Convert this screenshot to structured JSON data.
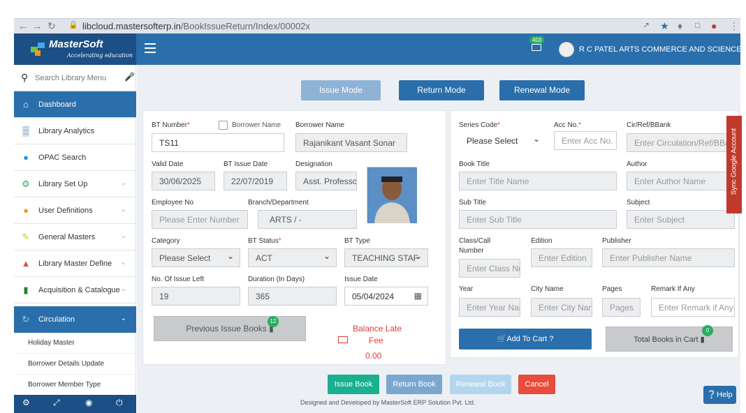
{
  "browser": {
    "url_host": "libcloud.mastersofterp.in",
    "url_path": "/BookIssueReturn/Index/00002x"
  },
  "brand": {
    "name": "MasterSoft",
    "tagline": "Accelerating education"
  },
  "header": {
    "mail_count": "403",
    "college": "R C PATEL ARTS COMMERCE AND SCIENCE COLLEGE"
  },
  "sidebar": {
    "search_placeholder": "Search Library Menu",
    "items": [
      {
        "label": "Dashboard",
        "icon": "home-icon"
      },
      {
        "label": "Library Analytics",
        "icon": "bar-chart-icon"
      },
      {
        "label": "OPAC Search",
        "icon": "globe-icon"
      },
      {
        "label": "Library Set Up",
        "icon": "gears-icon"
      },
      {
        "label": "User Definitions",
        "icon": "users-icon"
      },
      {
        "label": "General Masters",
        "icon": "edit-icon"
      },
      {
        "label": "Library Master Define",
        "icon": "sitemap-icon"
      },
      {
        "label": "Acquisition & Catalogue",
        "icon": "book-icon"
      },
      {
        "label": "Circulation",
        "icon": "refresh-icon"
      }
    ],
    "subitems": [
      "Holiday Master",
      "Borrower Details Update",
      "Borrower Member Type"
    ]
  },
  "modes": {
    "issue": "Issue Mode",
    "return": "Return Mode",
    "renewal": "Renewal Mode"
  },
  "left": {
    "bt_number_label": "BT Number",
    "bt_number": "TS11",
    "borrower_name_check": "Borrower Name",
    "borrower_name_label": "Borrower Name",
    "borrower_name": "Rajanikant Vasant Sonar",
    "valid_date_label": "Valid Date",
    "valid_date": "30/06/2025",
    "bt_issue_date_label": "BT Issue Date",
    "bt_issue_date": "22/07/2019",
    "designation_label": "Designation",
    "designation": "Asst. Professo",
    "employee_no_label": "Employee No",
    "employee_no_ph": "Please Enter Number",
    "branch_label": "Branch/Department",
    "branch": "ARTS / -",
    "category_label": "Category",
    "category": "Please Select",
    "bt_status_label": "BT Status",
    "bt_status": "ACT",
    "bt_type_label": "BT Type",
    "bt_type": "TEACHING STAF",
    "issue_left_label": "No. Of Issue Left",
    "issue_left": "19",
    "duration_label": "Duration (In Days)",
    "duration": "365",
    "issue_date_label": "Issue Date",
    "issue_date": "05/04/2024",
    "prev_books": "Previous Issue Books",
    "prev_count": "12",
    "balance_label_1": "Balance Late",
    "balance_label_2": "Fee",
    "balance_value": "0.00"
  },
  "right": {
    "series_label": "Series Code",
    "series": "Please Select",
    "acc_label": "Acc No.",
    "acc_ph": "Enter Acc No.",
    "cir_label": "Cir/Ref/BBank",
    "cir_ph": "Enter Circulation/Ref/BBank",
    "title_label": "Book Title",
    "title_ph": "Enter Title Name",
    "author_label": "Author",
    "author_ph": "Enter Author Name",
    "subtitle_label": "Sub Title",
    "subtitle_ph": "Enter Sub Title",
    "subject_label": "Subject",
    "subject_ph": "Enter Subject",
    "class_label_1": "Class/Call",
    "class_label_2": "Number",
    "class_ph": "Enter Class Nu",
    "edition_label": "Edition",
    "edition_ph": "Enter Edition",
    "publisher_label": "Publisher",
    "publisher_ph": "Enter Publisher Name",
    "year_label": "Year",
    "year_ph": "Enter Year Nar",
    "city_label": "City Name",
    "city_ph": "Enter City Nan",
    "pages_label": "Pages",
    "pages_ph": "Pages",
    "remark_label": "Remark If Any",
    "remark_ph": "Enter Remark if Any",
    "add_cart": "Add To Cart ?",
    "total_cart": "Total Books in Cart",
    "cart_count": "0"
  },
  "actions": {
    "issue": "Issue Book",
    "return": "Return Book",
    "renewal": "Renewal Book",
    "cancel": "Cancel"
  },
  "side_tab": "Sync Google Account",
  "help": "Help",
  "footer": "Designed and Developed by MasterSoft ERP Solution Pvt. Ltd.",
  "colors": {
    "primary": "#2a6fab",
    "brand_dark": "#1b4f86",
    "success": "#27ae60",
    "danger": "#e53935",
    "teal": "#1aaf8e"
  }
}
